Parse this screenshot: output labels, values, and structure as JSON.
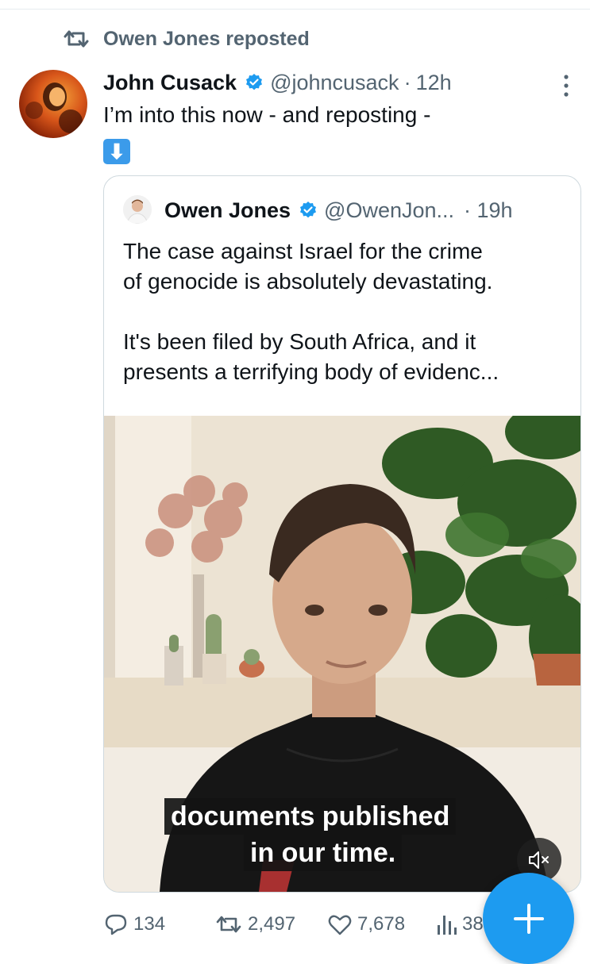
{
  "repost_banner": {
    "text": "Owen Jones reposted"
  },
  "tweet": {
    "author_name": "John Cusack",
    "handle": "@johncusack",
    "separator": "·",
    "time": "12h",
    "text": "I’m into this now - and reposting -",
    "emoji": "⬇"
  },
  "quoted_tweet": {
    "author_name": "Owen Jones",
    "handle": "@OwenJon...",
    "time": "· 19h",
    "text": "The case against Israel for the crime\nof genocide is absolutely devastating.\n\nIt's been filed by South Africa, and it\npresents a terrifying body of evidenc...",
    "video": {
      "caption_line1": "documents published",
      "caption_line2": "in our time.",
      "muted": true
    }
  },
  "actions": {
    "replies": "134",
    "reposts": "2,497",
    "likes": "7,678",
    "views": "38"
  },
  "fab": {
    "icon": "plus-icon"
  },
  "colors": {
    "accent": "#1d9bf0",
    "secondary_text": "#536471",
    "border": "#cfd9de"
  }
}
